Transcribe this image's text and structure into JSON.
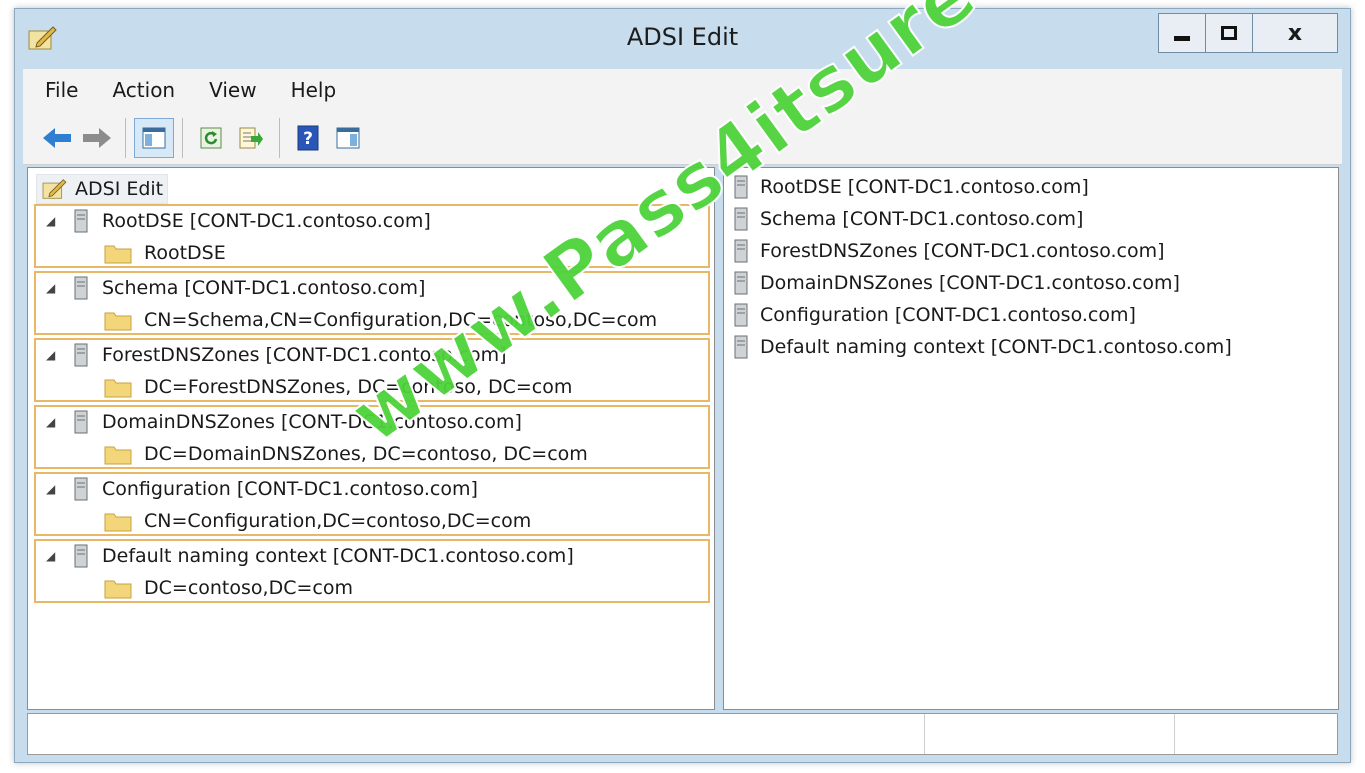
{
  "window": {
    "title": "ADSI Edit"
  },
  "caption": {
    "close_glyph": "x"
  },
  "menu": [
    "File",
    "Action",
    "View",
    "Help"
  ],
  "tree": {
    "root": "ADSI Edit",
    "groups": [
      {
        "server": "RootDSE [CONT-DC1.contoso.com]",
        "child": "RootDSE"
      },
      {
        "server": "Schema [CONT-DC1.contoso.com]",
        "child": "CN=Schema,CN=Configuration,DC=contoso,DC=com"
      },
      {
        "server": "ForestDNSZones [CONT-DC1.contoso.com]",
        "child": "DC=ForestDNSZones, DC=contoso, DC=com"
      },
      {
        "server": "DomainDNSZones [CONT-DC1.contoso.com]",
        "child": "DC=DomainDNSZones, DC=contoso, DC=com"
      },
      {
        "server": "Configuration [CONT-DC1.contoso.com]",
        "child": "CN=Configuration,DC=contoso,DC=com"
      },
      {
        "server": "Default naming context [CONT-DC1.contoso.com]",
        "child": "DC=contoso,DC=com"
      }
    ]
  },
  "list": [
    "RootDSE [CONT-DC1.contoso.com]",
    "Schema [CONT-DC1.contoso.com]",
    "ForestDNSZones [CONT-DC1.contoso.com]",
    "DomainDNSZones [CONT-DC1.contoso.com]",
    "Configuration [CONT-DC1.contoso.com]",
    "Default naming context [CONT-DC1.contoso.com]"
  ],
  "watermark": "www.Pass4itsure.com",
  "colors": {
    "group_border": "#e8b867",
    "window_frame": "#c7dcec",
    "watermark": "#4ed33a"
  }
}
